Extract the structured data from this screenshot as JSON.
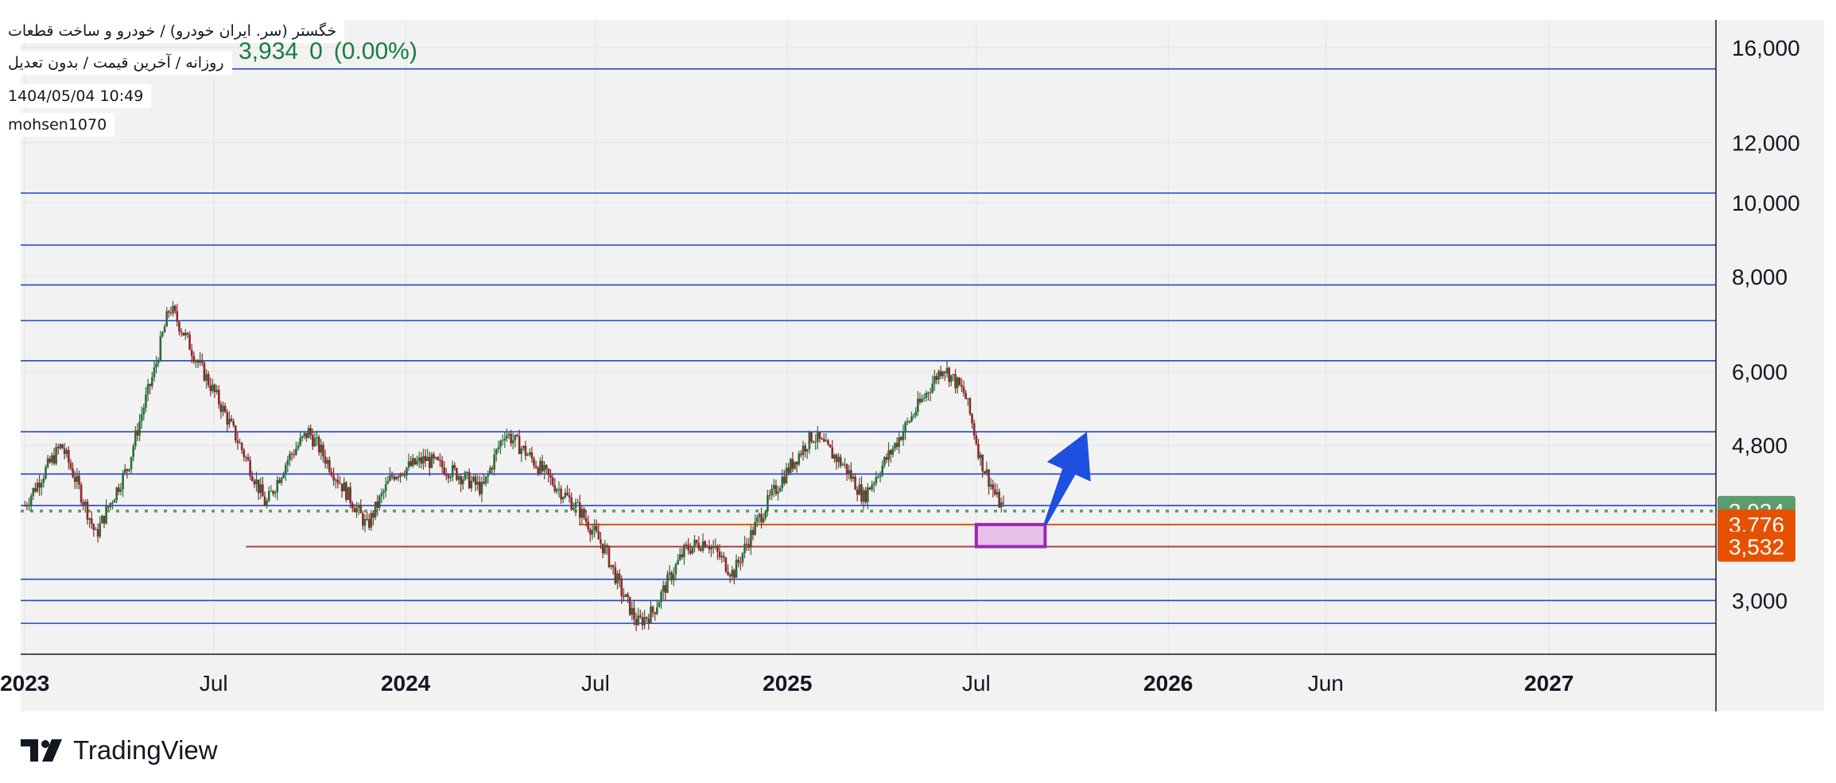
{
  "legend": {
    "symbol_line": "خگستر (سر. ایران خودرو) / خودرو و ساخت قطعات",
    "settings_line": "روزانه / آخرین قیمت / بدون تعدیل",
    "datetime": "1404/05/04 10:49",
    "author": "mohsen1070"
  },
  "price_header": {
    "last": "3,934",
    "change": "0",
    "change_pct": "(0.00%)"
  },
  "brand": {
    "name": "TradingView",
    "icon": "tradingview-logo-icon"
  },
  "colors": {
    "level_line": "#2346c8",
    "support_line": "#b33a3a",
    "zone_border": "#9c27b0",
    "zone_fill": "#e7c1ea",
    "arrow": "#1e4fe0",
    "last_price": "#5b9c6e",
    "label_orange": "#e65100",
    "candle_up": "#2e6b3a",
    "candle_down": "#8a2a2a",
    "plot_bg": "#f2f2f2"
  },
  "chart_data": {
    "type": "candlestick",
    "scale": "log",
    "x_range": [
      "2022-12-28",
      "2027-06-10"
    ],
    "ylim": [
      2550,
      17400
    ],
    "y_ticks": [
      {
        "value": 16000,
        "label": "16,000"
      },
      {
        "value": 12000,
        "label": "12,000"
      },
      {
        "value": 10000,
        "label": "10,000"
      },
      {
        "value": 8000,
        "label": "8,000"
      },
      {
        "value": 6000,
        "label": "6,000"
      },
      {
        "value": 4800,
        "label": "4,800"
      },
      {
        "value": 3000,
        "label": "3,000"
      }
    ],
    "x_ticks": [
      {
        "date": "2023-01-01",
        "label": "2023",
        "bold": true
      },
      {
        "date": "2023-07-01",
        "label": "Jul",
        "bold": false
      },
      {
        "date": "2024-01-01",
        "label": "2024",
        "bold": true
      },
      {
        "date": "2024-07-01",
        "label": "Jul",
        "bold": false
      },
      {
        "date": "2025-01-01",
        "label": "2025",
        "bold": true
      },
      {
        "date": "2025-07-01",
        "label": "Jul",
        "bold": false
      },
      {
        "date": "2026-01-01",
        "label": "2026",
        "bold": true
      },
      {
        "date": "2026-06-01",
        "label": "Jun",
        "bold": false
      },
      {
        "date": "2027-01-01",
        "label": "2027",
        "bold": true
      }
    ],
    "horizontal_levels": [
      15000,
      10300,
      8800,
      7800,
      7000,
      6200,
      5000,
      4400,
      4000,
      3200,
      3000,
      2800
    ],
    "support_line": {
      "value": 3532,
      "from": "2023-08-01"
    },
    "resistance_line": {
      "value": 3776,
      "from": "2024-06-15"
    },
    "last_price_line": {
      "value": 3934,
      "label": "3,934"
    },
    "price_labels": [
      {
        "value": 3934,
        "label": "3,934",
        "color": "#5b9c6e"
      },
      {
        "value": 3776,
        "label": "3,776",
        "color": "#e65100"
      },
      {
        "value": 3532,
        "label": "3,532",
        "color": "#e65100"
      }
    ],
    "zone": {
      "x1": "2025-07-01",
      "x2": "2025-09-05",
      "y_top": 3776,
      "y_bottom": 3532
    },
    "arrow": {
      "from": [
        "2025-09-05",
        3776
      ],
      "to": [
        "2025-10-15",
        5000
      ]
    },
    "price_path": [
      [
        "2023-01-01",
        4000
      ],
      [
        "2023-02-05",
        4800
      ],
      [
        "2023-03-10",
        3650
      ],
      [
        "2023-04-10",
        4500
      ],
      [
        "2023-05-05",
        6000
      ],
      [
        "2023-05-20",
        7300
      ],
      [
        "2023-06-15",
        6200
      ],
      [
        "2023-07-20",
        5000
      ],
      [
        "2023-08-20",
        4000
      ],
      [
        "2023-09-10",
        4600
      ],
      [
        "2023-09-30",
        5000
      ],
      [
        "2023-10-25",
        4400
      ],
      [
        "2023-11-25",
        3750
      ],
      [
        "2023-12-20",
        4400
      ],
      [
        "2024-01-20",
        4600
      ],
      [
        "2024-02-20",
        4400
      ],
      [
        "2024-03-15",
        4200
      ],
      [
        "2024-04-05",
        5000
      ],
      [
        "2024-04-25",
        4700
      ],
      [
        "2024-05-20",
        4300
      ],
      [
        "2024-06-15",
        3950
      ],
      [
        "2024-07-10",
        3500
      ],
      [
        "2024-07-25",
        3100
      ],
      [
        "2024-08-10",
        2800
      ],
      [
        "2024-08-25",
        2900
      ],
      [
        "2024-09-25",
        3500
      ],
      [
        "2024-10-15",
        3600
      ],
      [
        "2024-11-10",
        3250
      ],
      [
        "2024-12-05",
        3850
      ],
      [
        "2024-12-25",
        4300
      ],
      [
        "2025-01-25",
        4950
      ],
      [
        "2025-02-25",
        4500
      ],
      [
        "2025-03-15",
        4100
      ],
      [
        "2025-04-10",
        4700
      ],
      [
        "2025-05-10",
        5500
      ],
      [
        "2025-05-30",
        6100
      ],
      [
        "2025-06-20",
        5600
      ],
      [
        "2025-07-05",
        4600
      ],
      [
        "2025-07-20",
        4100
      ],
      [
        "2025-07-28",
        3934
      ]
    ],
    "y_axis_position": "right",
    "grid": true
  }
}
